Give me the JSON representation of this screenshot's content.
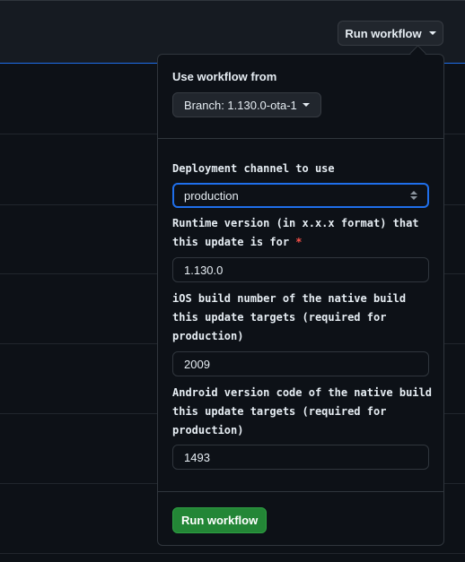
{
  "header": {
    "run_workflow_label": "Run workflow"
  },
  "dropdown": {
    "use_workflow_from_label": "Use workflow from",
    "branch_label": "Branch: 1.130.0-ota-1",
    "inputs": [
      {
        "label": "Deployment channel to use",
        "value": "production",
        "type": "select",
        "required": false
      },
      {
        "label": "Runtime version (in x.x.x format) that this update is for",
        "value": "1.130.0",
        "type": "text",
        "required": true
      },
      {
        "label": "iOS build number of the native build this update targets (required for production)",
        "value": "2009",
        "type": "text",
        "required": false
      },
      {
        "label": "Android version code of the native build this update targets (required for production)",
        "value": "1493",
        "type": "text",
        "required": false
      }
    ],
    "required_marker": "*",
    "submit_label": "Run workflow"
  },
  "colors": {
    "background": "#0d1117",
    "accent_blue": "#1f6feb",
    "primary_green": "#238636",
    "required_red": "#f85149"
  }
}
